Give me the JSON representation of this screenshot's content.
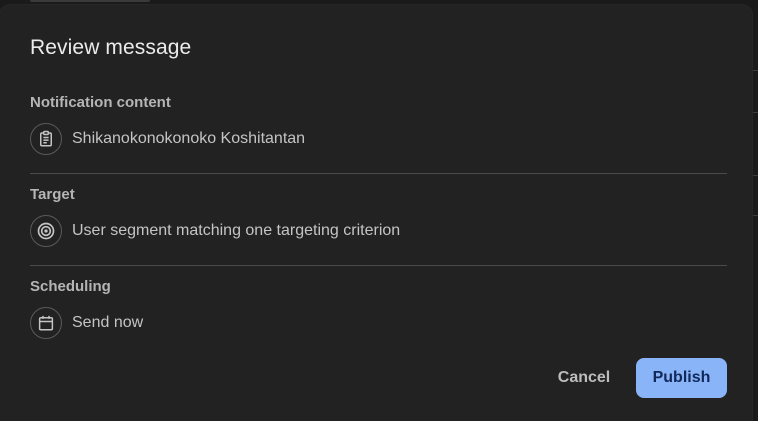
{
  "dialog": {
    "title": "Review message",
    "sections": [
      {
        "label": "Notification content",
        "icon": "clipboard-icon",
        "text": "Shikanokonokonoko Koshitantan"
      },
      {
        "label": "Target",
        "icon": "target-icon",
        "text": "User segment matching one targeting criterion"
      },
      {
        "label": "Scheduling",
        "icon": "calendar-icon",
        "text": "Send now"
      }
    ],
    "actions": {
      "cancel_label": "Cancel",
      "publish_label": "Publish"
    }
  },
  "colors": {
    "background": "#222222",
    "accent": "#8ab4f8",
    "accent_text": "#11285a"
  }
}
